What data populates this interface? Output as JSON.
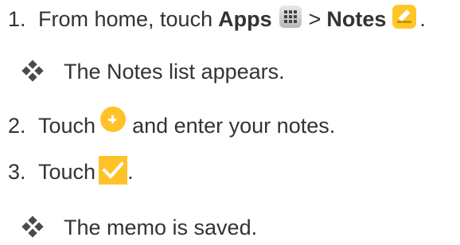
{
  "steps": [
    {
      "number": "1.",
      "text_before": "From home, touch",
      "apps_label": "Apps",
      "separator": ">",
      "notes_label": "Notes",
      "text_after": "."
    },
    {
      "result": "The Notes list appears."
    },
    {
      "number": "2.",
      "text_before": "Touch",
      "text_after": "and enter your notes."
    },
    {
      "number": "3.",
      "text_before": "Touch",
      "text_after": "."
    },
    {
      "result": "The memo is saved."
    }
  ],
  "icons": {
    "apps": "apps-grid-icon",
    "notes": "notes-app-icon",
    "add": "add-note-icon",
    "save": "checkmark-save-icon",
    "bullet": "four-diamond-bullet-icon"
  },
  "colors": {
    "text": "#333333",
    "accent_yellow": "#ffc229"
  }
}
